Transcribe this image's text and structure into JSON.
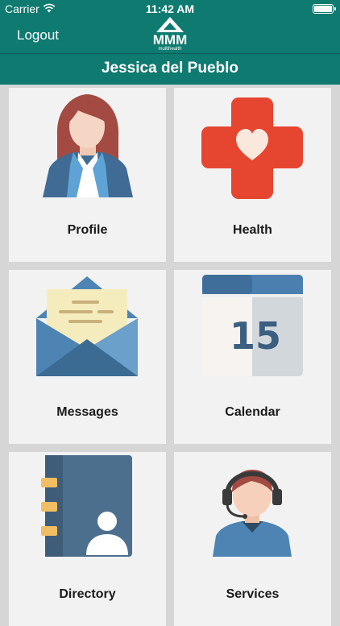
{
  "status_bar": {
    "carrier": "Carrier",
    "time": "11:42 AM"
  },
  "header": {
    "logout": "Logout",
    "logo_text": "MMM",
    "logo_subtext": "multihealth",
    "user_name": "Jessica del Pueblo"
  },
  "tiles": [
    {
      "label": "Profile",
      "icon": "profile-icon"
    },
    {
      "label": "Health",
      "icon": "health-icon"
    },
    {
      "label": "Messages",
      "icon": "messages-icon"
    },
    {
      "label": "Calendar",
      "icon": "calendar-icon",
      "calendar_day": "15"
    },
    {
      "label": "Directory",
      "icon": "directory-icon"
    },
    {
      "label": "Services",
      "icon": "services-icon"
    }
  ],
  "colors": {
    "header_bg": "#0e7a70",
    "tile_bg": "#f2f2f2",
    "health_red": "#e6452f"
  }
}
